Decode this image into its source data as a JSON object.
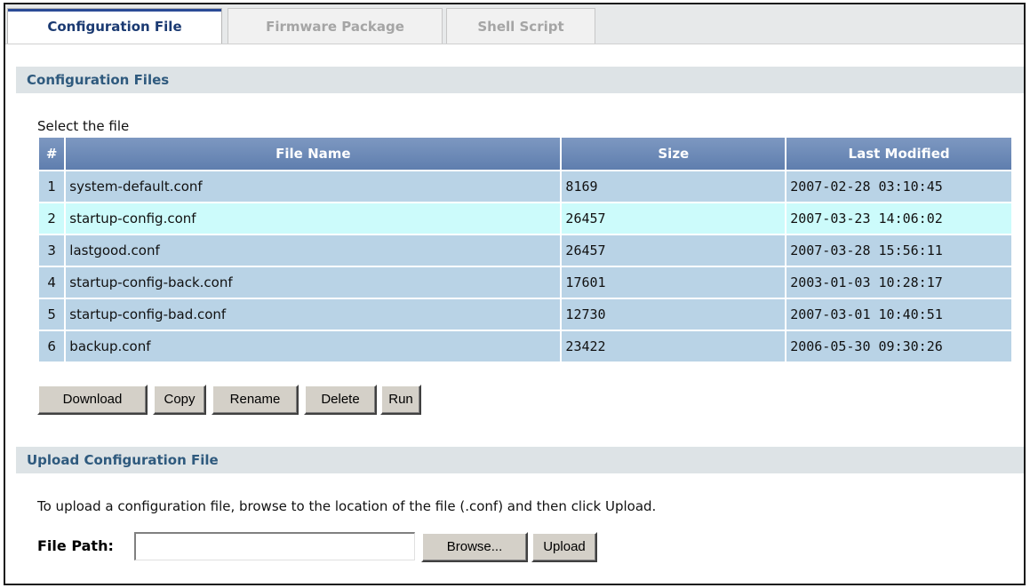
{
  "tabs": [
    {
      "label": "Configuration File"
    },
    {
      "label": "Firmware Package"
    },
    {
      "label": "Shell Script"
    }
  ],
  "config_section": {
    "title": "Configuration Files",
    "select_label": "Select the file",
    "columns": [
      "#",
      "File Name",
      "Size",
      "Last Modified"
    ],
    "rows": [
      {
        "num": "1",
        "name": "system-default.conf",
        "size": "8169",
        "modified": "2007-02-28 03:10:45"
      },
      {
        "num": "2",
        "name": "startup-config.conf",
        "size": "26457",
        "modified": "2007-03-23 14:06:02"
      },
      {
        "num": "3",
        "name": "lastgood.conf",
        "size": "26457",
        "modified": "2007-03-28 15:56:11"
      },
      {
        "num": "4",
        "name": "startup-config-back.conf",
        "size": "17601",
        "modified": "2003-01-03 10:28:17"
      },
      {
        "num": "5",
        "name": "startup-config-bad.conf",
        "size": "12730",
        "modified": "2007-03-01 10:40:51"
      },
      {
        "num": "6",
        "name": "backup.conf",
        "size": "23422",
        "modified": "2006-05-30 09:30:26"
      }
    ]
  },
  "actions": {
    "download": "Download",
    "copy": "Copy",
    "rename": "Rename",
    "delete": "Delete",
    "run": "Run"
  },
  "upload_section": {
    "title": "Upload Configuration File",
    "instructions": "To upload a configuration file, browse to the location of the file (.conf) and then click Upload.",
    "file_path_label": "File Path:",
    "file_path_value": "",
    "browse_label": "Browse...",
    "upload_label": "Upload"
  },
  "colors": {
    "header_bg": "#6f8cb7",
    "row_bg": "#b9d3e6",
    "row_highlight": "#ccfbfb",
    "section_bg": "#dde3e6",
    "section_text": "#2f5a7e"
  }
}
